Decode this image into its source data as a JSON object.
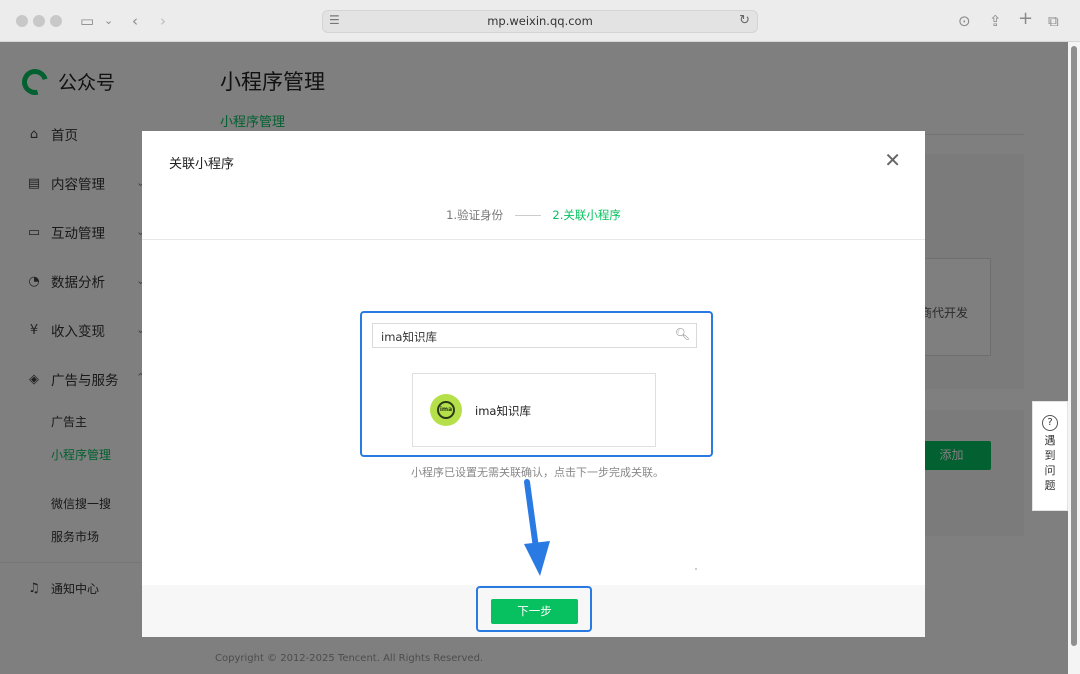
{
  "browser": {
    "url": "mp.weixin.qq.com"
  },
  "sidebar": {
    "logo_text": "公众号",
    "items": [
      {
        "label": "首页",
        "icon": "home-icon"
      },
      {
        "label": "内容管理",
        "icon": "document-icon"
      },
      {
        "label": "互动管理",
        "icon": "chat-icon"
      },
      {
        "label": "数据分析",
        "icon": "pie-chart-icon"
      },
      {
        "label": "收入变现",
        "icon": "yen-icon"
      },
      {
        "label": "广告与服务",
        "icon": "compass-icon"
      }
    ],
    "subitems": [
      {
        "label": "广告主"
      },
      {
        "label": "小程序管理"
      },
      {
        "label": "微信搜一搜"
      },
      {
        "label": "服务市场"
      }
    ],
    "notification": "通知中心"
  },
  "main": {
    "title": "小程序管理",
    "tab": "小程序管理",
    "dev_partial": "商代开发",
    "add_button": "添加",
    "footer": "Copyright © 2012-2025 Tencent. All Rights Reserved."
  },
  "help_float": {
    "icon": "?",
    "text": "遇到问题"
  },
  "dialog": {
    "title": "关联小程序",
    "step1": "1.验证身份",
    "step2": "2.关联小程序",
    "search_value": "ima知识库",
    "result_name": "ima知识库",
    "avatar_text": "ima",
    "hint": "小程序已设置无需关联确认，点击下一步完成关联。",
    "next_button": "下一步"
  },
  "colors": {
    "accent": "#07c160",
    "annotation": "#2a7ae4"
  }
}
